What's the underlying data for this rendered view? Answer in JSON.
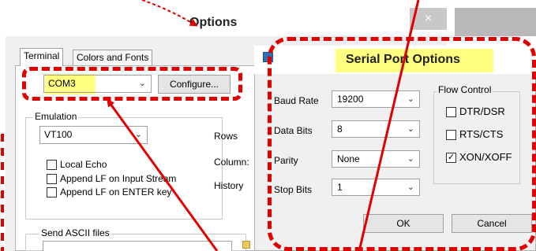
{
  "window": {
    "title": "Options",
    "close_glyph": "×"
  },
  "tabs": [
    {
      "label": "Terminal",
      "active": true
    },
    {
      "label": "Colors and Fonts",
      "active": false
    }
  ],
  "terminal": {
    "port_value": "COM3",
    "configure_label": "Configure...",
    "emulation_label": "Emulation",
    "emulation_value": "VT100",
    "rows_label": "Rows",
    "columns_label": "Column:",
    "history_label": "History",
    "local_echo_label": "Local Echo",
    "local_echo_checked": false,
    "append_lf_input_label": "Append LF on Input Stream",
    "append_lf_input_checked": false,
    "append_lf_enter_label": "Append LF on ENTER key",
    "append_lf_enter_checked": false,
    "send_ascii_label": "Send ASCII files"
  },
  "serial_port_dialog": {
    "title": "Serial Port Options",
    "baud_rate_label": "Baud Rate",
    "baud_rate_value": "19200",
    "data_bits_label": "Data Bits",
    "data_bits_value": "8",
    "parity_label": "Parity",
    "parity_value": "None",
    "stop_bits_label": "Stop Bits",
    "stop_bits_value": "1",
    "flow_control_label": "Flow Control",
    "dtr_dsr_label": "DTR/DSR",
    "dtr_dsr_checked": false,
    "rts_cts_label": "RTS/CTS",
    "rts_cts_checked": false,
    "xon_xoff_label": "XON/XOFF",
    "xon_xoff_checked": true,
    "ok_label": "OK",
    "cancel_label": "Cancel"
  },
  "colors": {
    "annotation_red": "#e10000",
    "highlight_yellow": "#ffff80"
  },
  "icons": [
    "close-icon",
    "chevron-down-icon",
    "checkmark-icon",
    "serial-port-dialog-icon",
    "annotation-arrow-icon"
  ]
}
